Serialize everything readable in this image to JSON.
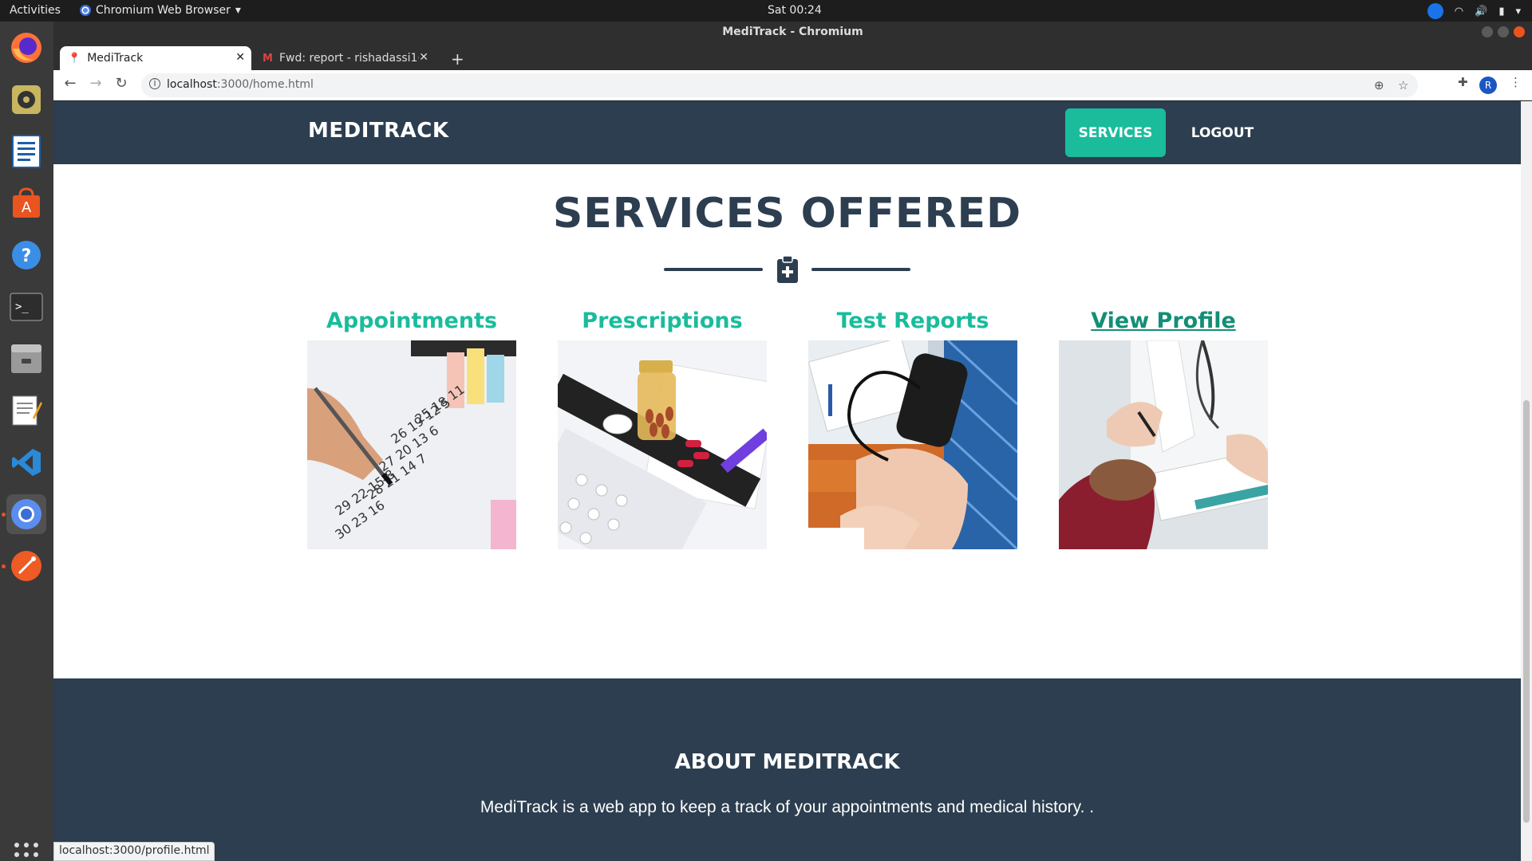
{
  "system": {
    "activities": "Activities",
    "app_menu": "Chromium Web Browser",
    "clock": "Sat 00:24"
  },
  "browser": {
    "window_title": "MediTrack - Chromium",
    "tabs": [
      {
        "label": "MediTrack"
      },
      {
        "label": "Fwd: report - rishadassi1("
      }
    ],
    "url_host": "localhost",
    "url_path": ":3000/home.html",
    "profile_initial": "R",
    "status_url": "localhost:3000/profile.html"
  },
  "site": {
    "brand": "MEDITRACK",
    "nav": {
      "services": "SERVICES",
      "logout": "LOGOUT"
    },
    "services_title": "SERVICES OFFERED",
    "services": [
      {
        "title": "Appointments",
        "image": "calendar-photo"
      },
      {
        "title": "Prescriptions",
        "image": "medicine-photo"
      },
      {
        "title": "Test Reports",
        "image": "blood-pressure-photo"
      },
      {
        "title": "View Profile",
        "image": "doctor-consultation-photo"
      }
    ],
    "about_title": "ABOUT MEDITRACK",
    "about_text": "MediTrack is a web app to keep a track of your appointments and medical history. ."
  },
  "colors": {
    "navy": "#2c3e50",
    "teal": "#1abc9c",
    "ubuntu_orange": "#e95420"
  }
}
